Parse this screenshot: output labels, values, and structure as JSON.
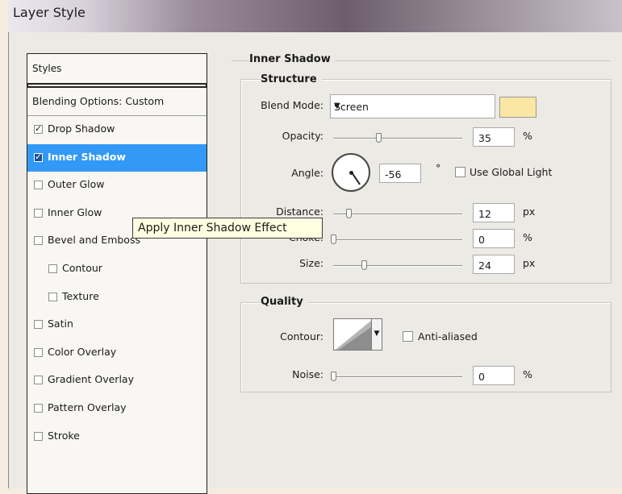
{
  "window": {
    "title": "Layer Style"
  },
  "styles_panel": {
    "header": "Styles",
    "blending_options": "Blending Options: Custom",
    "items": [
      {
        "label": "Drop Shadow",
        "checked": true,
        "selected": false,
        "indent": false
      },
      {
        "label": "Inner Shadow",
        "checked": true,
        "selected": true,
        "indent": false
      },
      {
        "label": "Outer Glow",
        "checked": false,
        "selected": false,
        "indent": false
      },
      {
        "label": "Inner Glow",
        "checked": false,
        "selected": false,
        "indent": false
      },
      {
        "label": "Bevel and Emboss",
        "checked": false,
        "selected": false,
        "indent": false
      },
      {
        "label": "Contour",
        "checked": false,
        "selected": false,
        "indent": true
      },
      {
        "label": "Texture",
        "checked": false,
        "selected": false,
        "indent": true
      },
      {
        "label": "Satin",
        "checked": false,
        "selected": false,
        "indent": false
      },
      {
        "label": "Color Overlay",
        "checked": false,
        "selected": false,
        "indent": false
      },
      {
        "label": "Gradient Overlay",
        "checked": false,
        "selected": false,
        "indent": false
      },
      {
        "label": "Pattern Overlay",
        "checked": false,
        "selected": false,
        "indent": false
      },
      {
        "label": "Stroke",
        "checked": false,
        "selected": false,
        "indent": false
      }
    ]
  },
  "tooltip": {
    "text": "Apply Inner Shadow Effect"
  },
  "inner_shadow": {
    "title": "Inner Shadow",
    "structure": {
      "title": "Structure",
      "blend_mode_label": "Blend Mode:",
      "blend_mode_value": "Screen",
      "shadow_color": "#fbe7a4",
      "opacity_label": "Opacity:",
      "opacity_value": "35",
      "opacity_unit": "%",
      "angle_label": "Angle:",
      "angle_value": "-56",
      "angle_unit": "°",
      "use_global_light_label": "Use Global Light",
      "distance_label": "Distance:",
      "distance_value": "12",
      "distance_unit": "px",
      "choke_label": "Choke:",
      "choke_value": "0",
      "choke_unit": "%",
      "size_label": "Size:",
      "size_value": "24",
      "size_unit": "px"
    },
    "quality": {
      "title": "Quality",
      "contour_label": "Contour:",
      "anti_aliased_label": "Anti-aliased",
      "noise_label": "Noise:",
      "noise_value": "0",
      "noise_unit": "%"
    }
  },
  "colors": {
    "selection": "#3299f6",
    "tooltip_bg": "#ffffe1"
  }
}
